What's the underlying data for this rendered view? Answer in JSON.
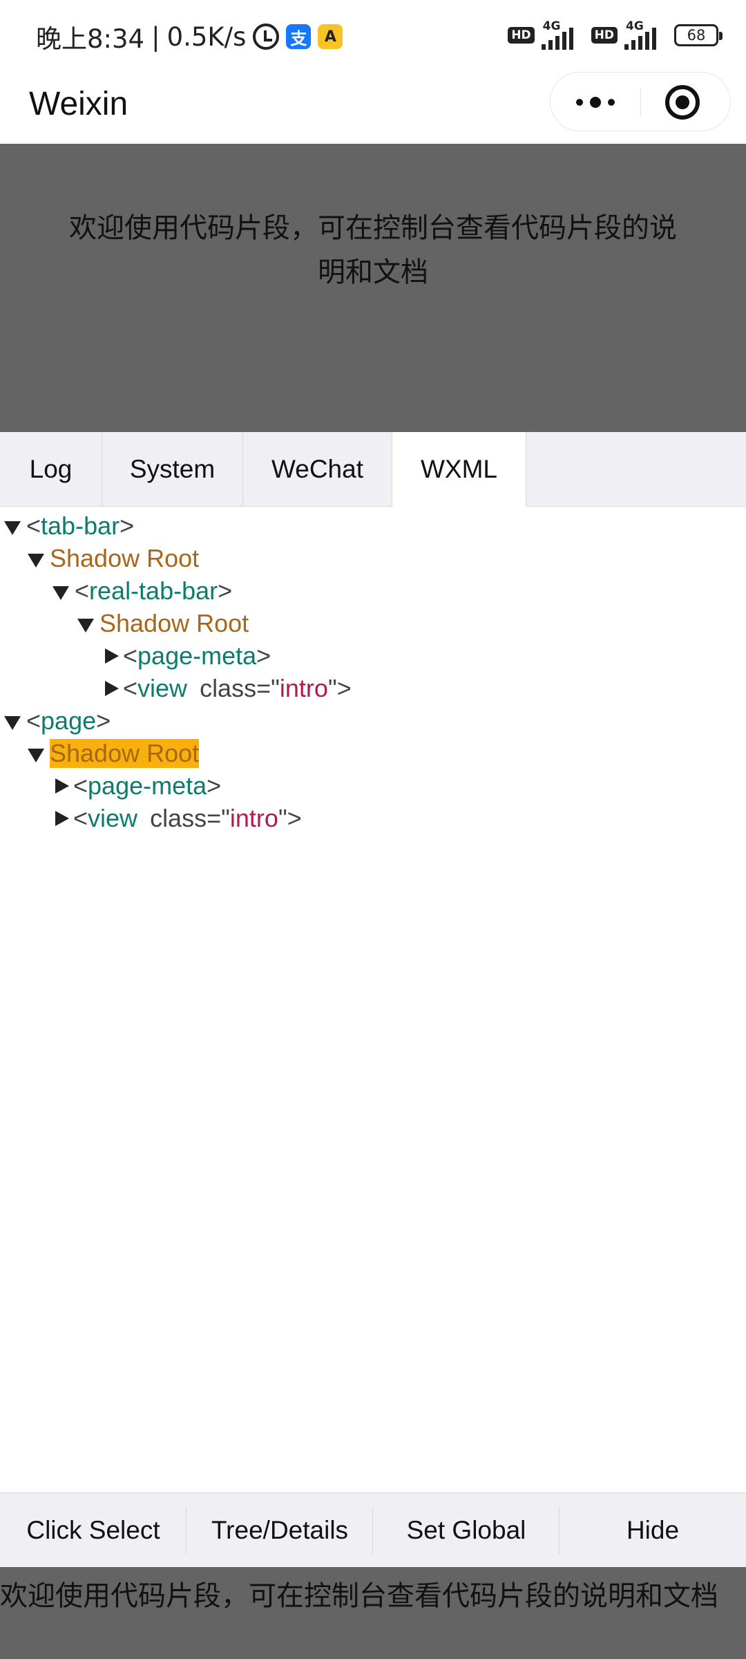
{
  "status_bar": {
    "time": "晚上8:34",
    "speed": "0.5K/s",
    "alipay_glyph": "支",
    "app_glyph": "A",
    "hd1": "HD",
    "net1": "4G",
    "hd2": "HD",
    "net2": "4G",
    "battery": "68"
  },
  "header": {
    "title": "Weixin"
  },
  "intro": {
    "text": "欢迎使用代码片段，可在控制台查看代码片段的说明和文档"
  },
  "tabs": [
    {
      "label": "Log"
    },
    {
      "label": "System"
    },
    {
      "label": "WeChat"
    },
    {
      "label": "WXML"
    }
  ],
  "tree": {
    "n1": {
      "tag": "tab-bar"
    },
    "n2": {
      "label": "Shadow Root"
    },
    "n3": {
      "tag": "real-tab-bar"
    },
    "n4": {
      "label": "Shadow Root"
    },
    "n5": {
      "tag": "page-meta"
    },
    "n6": {
      "tag": "view",
      "attr": "class",
      "value": "intro"
    },
    "n7": {
      "tag": "page"
    },
    "n8": {
      "label": "Shadow Root"
    },
    "n9": {
      "tag": "page-meta"
    },
    "n10": {
      "tag": "view",
      "attr": "class",
      "value": "intro"
    }
  },
  "toolbar": {
    "click_select": "Click Select",
    "tree_details": "Tree/Details",
    "set_global": "Set Global",
    "hide": "Hide"
  },
  "bottom_intro": {
    "text": "欢迎使用代码片段，可在控制台查看代码片段的说明和文档"
  },
  "colors": {
    "tag": "#0f7b6c",
    "shadow_root": "#a86619",
    "attr_value": "#b3194e",
    "highlight": "#f9b00c",
    "overlay_gray": "#646464"
  }
}
